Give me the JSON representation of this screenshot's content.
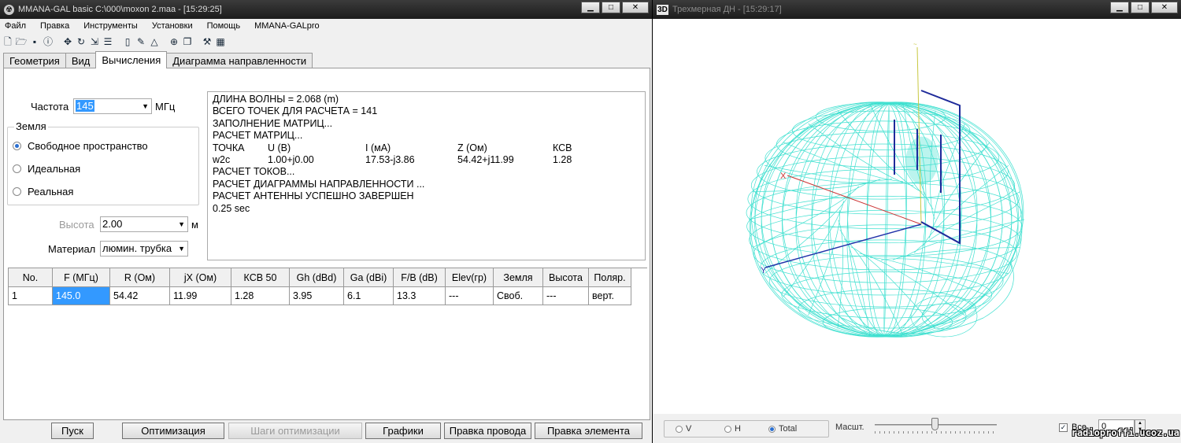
{
  "main_window": {
    "title": "MMANA-GAL basic C:\\000\\moxon 2.maa - [15:29:25]",
    "menu": [
      "Файл",
      "Правка",
      "Инструменты",
      "Установки",
      "Помощь",
      "MMANA-GALpro"
    ],
    "toolbar_icons": [
      "new-file",
      "open-folder",
      "save",
      "info",
      "move",
      "rotate",
      "scale",
      "split",
      "page",
      "edit-shape",
      "triangle",
      "target",
      "copy",
      "tools",
      "calculator"
    ],
    "tabs": [
      "Геометрия",
      "Вид",
      "Вычисления",
      "Диаграмма направленности"
    ],
    "active_tab": "Вычисления",
    "frequency": {
      "label": "Частота",
      "value": "145",
      "unit": "МГц"
    },
    "ground": {
      "title": "Земля",
      "options": [
        "Свободное пространство",
        "Идеальная",
        "Реальная"
      ],
      "selected": "Свободное пространство"
    },
    "height": {
      "label": "Высота",
      "value": "2.00",
      "unit": "м"
    },
    "material": {
      "label": "Материал",
      "value": "люмин. трубка"
    },
    "log": {
      "lines_top": [
        "ДЛИНА ВОЛНЫ = 2.068 (m)",
        "ВСЕГО ТОЧЕК ДЛЯ РАСЧЕТА = 141",
        "ЗАПОЛНЕНИЕ МАТРИЦ...",
        "РАСЧЕТ МАТРИЦ..."
      ],
      "header": [
        "ТОЧКА",
        "U (В)",
        "I (мА)",
        "Z (Ом)",
        "КСВ"
      ],
      "row": [
        "w2c",
        "1.00+j0.00",
        "17.53-j3.86",
        "54.42+j11.99",
        "1.28"
      ],
      "lines_bottom": [
        "РАСЧЕТ ТОКОВ...",
        "РАСЧЕТ ДИАГРАММЫ НАПРАВЛЕННОСТИ ...",
        "РАСЧЕТ АНТЕННЫ УСПЕШНО ЗАВЕРШЕН",
        "0.25 sec"
      ]
    },
    "table": {
      "columns": [
        "No.",
        "F (МГц)",
        "R (Ом)",
        "jX (Ом)",
        "КСВ 50",
        "Gh (dBd)",
        "Ga (dBi)",
        "F/B (dB)",
        "Elev(гр)",
        "Земля",
        "Высота",
        "Поляр."
      ],
      "rows": [
        [
          "1",
          "145.0",
          "54.42",
          "11.99",
          "1.28",
          "3.95",
          "6.1",
          "13.3",
          "---",
          "Своб.",
          "---",
          "верт."
        ]
      ]
    },
    "buttons": {
      "start": "Пуск",
      "optimize": "Оптимизация",
      "opt_steps": "Шаги оптимизации",
      "graphs": "Графики",
      "edit_wire": "Правка провода",
      "edit_element": "Правка элемента"
    }
  },
  "view_window": {
    "title": "Трехмерная ДН - [15:29:17]",
    "icon_label": "3D",
    "axes": {
      "x": "X",
      "y": "Y"
    },
    "colors": {
      "pattern": "#40e0d0",
      "wires": "#1e2a9a",
      "x_axis": "#cc3333",
      "y_axis": "#2233aa",
      "z_axis": "#c8c840"
    },
    "polarization": {
      "options": [
        "V",
        "H",
        "Total"
      ],
      "selected": "Total"
    },
    "scale_label": "Масшт.",
    "scale_position": 0.47,
    "all": {
      "label": "Все",
      "checked": true
    },
    "spin_value": "0"
  },
  "watermark": "radioproffi.ucoz.ua"
}
